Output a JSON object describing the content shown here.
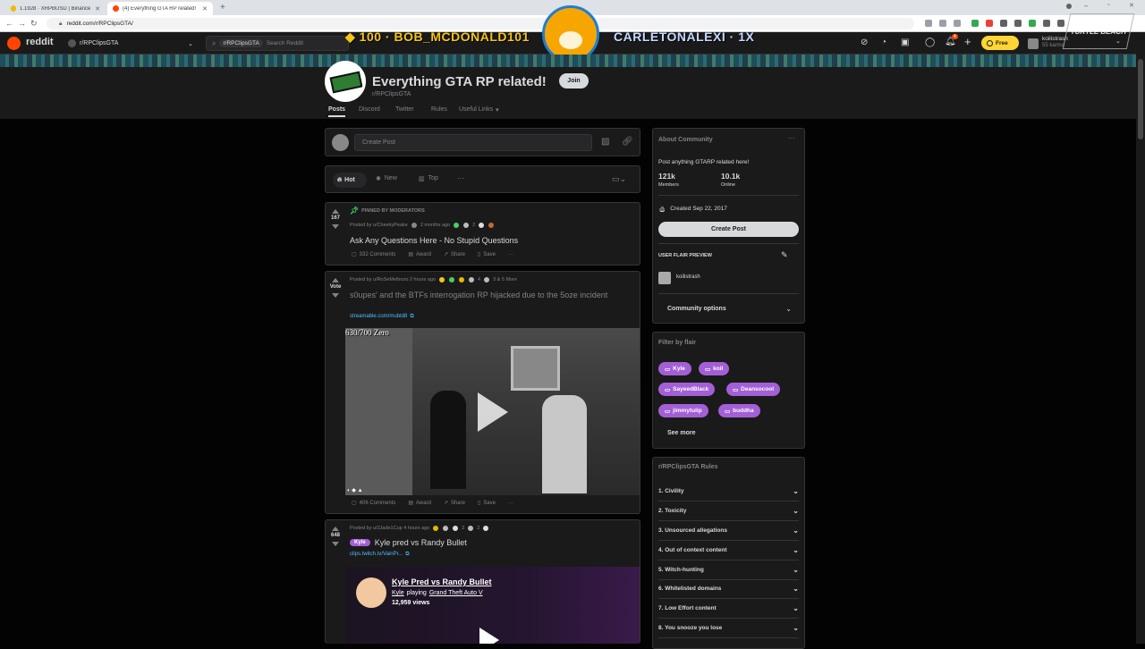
{
  "browser": {
    "tabs": [
      {
        "label": "1.1928 · XRPBUSD | Binance Sp..."
      },
      {
        "label": "(4) Everything GTA RP related!"
      }
    ],
    "url": "reddit.com/r/RPClipsGTA/"
  },
  "header": {
    "logo_text": "reddit",
    "community_switch": "r/RPClipsGTA",
    "search_chip": "r/RPClipsGTA",
    "search_placeholder": "Search Reddit",
    "overlay_left": "◆ 100 · BOB_MCDONALD101",
    "overlay_right": "CARLETONALEXI · 1X",
    "overlay_count": "86",
    "free_label": "Free",
    "username": "koilistrash",
    "karma": "55 karma",
    "notif_count": "4",
    "watermark": "TURTLE BEACH"
  },
  "subreddit": {
    "title": "Everything GTA RP related!",
    "name": "r/RPClipsGTA",
    "join_label": "Join",
    "tabs": [
      "Posts",
      "Discord",
      "Twitter",
      "Rules",
      "Useful Links"
    ]
  },
  "create_post": {
    "placeholder": "Create Post"
  },
  "sort": {
    "hot": "Hot",
    "new": "New",
    "top": "Top",
    "more": "···"
  },
  "posts": [
    {
      "pinned_label": "PINNED BY MODERATORS",
      "votes": "167",
      "meta": "Posted by u/CheekyPeake",
      "time": "2 months ago",
      "award_count": "2",
      "title": "Ask Any Questions Here - No Stupid Questions",
      "comments": "332 Comments",
      "award": "Award",
      "share": "Share",
      "save": "Save",
      "more": "···"
    },
    {
      "votes": "Vote",
      "meta": "Posted by u/RoSeMeltrozo 2 hours ago",
      "award_count": "4",
      "extra": "3 & 5 More",
      "title": "s0upes' and the BTFs interrogation RP hijacked due to the 5oze incident",
      "link": "streamable.com/mubtd8",
      "video_caption": "630/700 Zero",
      "comments": "406 Comments",
      "award": "Award",
      "share": "Share",
      "save": "Save",
      "more": "···"
    },
    {
      "votes": "648",
      "meta": "Posted by u/2Jade1Cup 4 hours ago",
      "award_count_a": "2",
      "award_count_b": "2",
      "flair": "Kyle",
      "title": "Kyle pred vs Randy Bullet",
      "link": "clips.twitch.tv/VainPr...",
      "clip_title": "Kyle Pred vs Randy Bullet",
      "clip_user": "Kyle",
      "clip_playing": "playing",
      "clip_game": "Grand Theft Auto V",
      "clip_views": "12,959 views"
    }
  ],
  "about": {
    "heading": "About Community",
    "description": "Post anything GTARP related here!",
    "members_value": "121k",
    "members_label": "Members",
    "online_value": "10.1k",
    "online_label": "Online",
    "created": "Created Sep 22, 2017",
    "create_post_btn": "Create Post",
    "flair_preview_label": "USER FLAIR PREVIEW",
    "flair_user": "koilistrash",
    "options_label": "Community options"
  },
  "filter": {
    "heading": "Filter by flair",
    "flairs": [
      "Kyle",
      "koil",
      "SayeedBlack",
      "Deansocool",
      "jimmytulip",
      "buddha"
    ],
    "see_more": "See more"
  },
  "rules": {
    "heading": "r/RPClipsGTA Rules",
    "items": [
      "1. Civility",
      "2. Toxicity",
      "3. Unsourced allegations",
      "4. Out of context content",
      "5. Witch-hunting",
      "6. Whitelisted domains",
      "7. Low Effort content",
      "8. You snooze you lose"
    ]
  },
  "colors": {
    "accent": "#a35fd6",
    "background": "#030303",
    "card": "#1a1a1b",
    "reddit_orange": "#ff4500",
    "link": "#4fbcff"
  }
}
